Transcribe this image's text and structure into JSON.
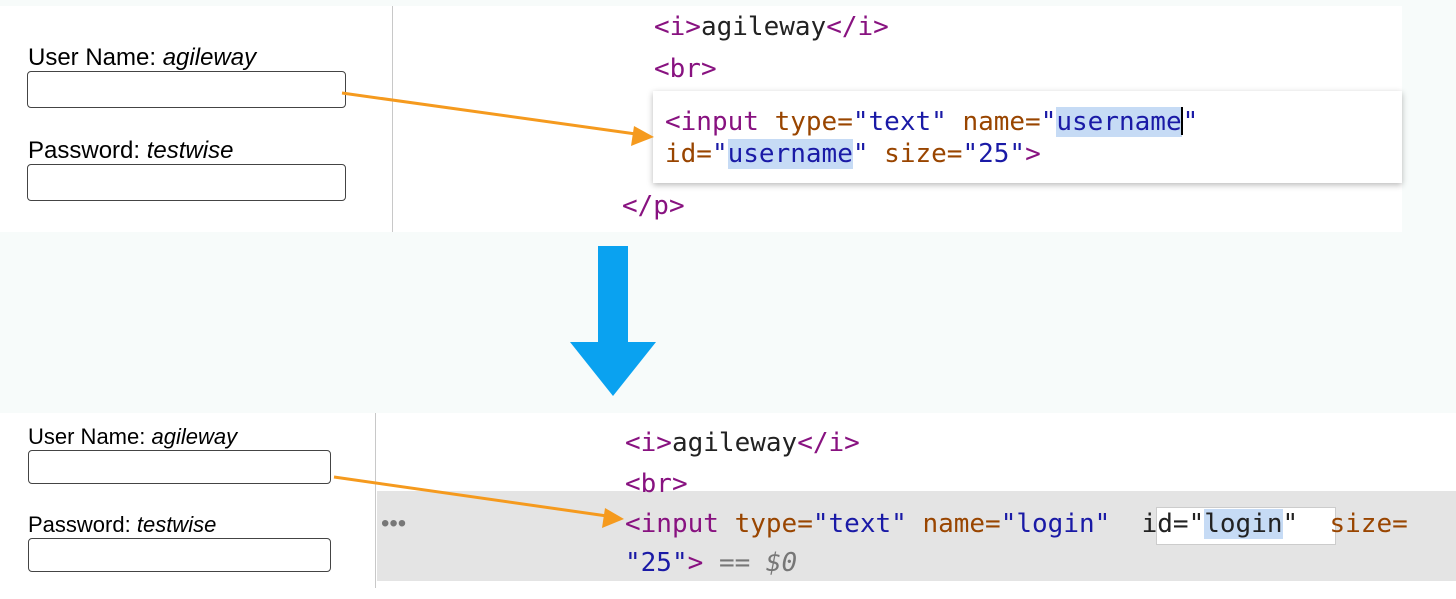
{
  "colors": {
    "pointer_arrow": "#f59a1e",
    "flow_arrow": "#0aa2f0",
    "tag": "#881280",
    "attribute": "#994500",
    "value": "#1a1aa6",
    "highlight": "#c6dbf5"
  },
  "before": {
    "form": {
      "username_label": "User Name:",
      "username_hint": "agileway",
      "password_label": "Password:",
      "password_hint": "testwise"
    },
    "code": {
      "line1": {
        "open": "<i>",
        "text": "agileway",
        "close": "</i>"
      },
      "line2": "<br>",
      "edit": {
        "open": "<input",
        "type_attr": "type=",
        "type_val": "\"text\"",
        "name_attr": "name=",
        "q1": "\"",
        "name_val": "username",
        "q2": "\"",
        "id_attr": "id=",
        "q3": "\"",
        "id_val": "username",
        "q4": "\"",
        "size_attr": "size=",
        "size_val": "\"25\"",
        "end": ">"
      },
      "line4": "</p>"
    }
  },
  "after": {
    "form": {
      "username_label": "User Name:",
      "username_hint": "agileway",
      "password_label": "Password:",
      "password_hint": "testwise"
    },
    "code": {
      "line1": {
        "open": "<i>",
        "text": "agileway",
        "close": "</i>"
      },
      "line2": "<br>",
      "row": {
        "ellipsis": "•••",
        "open": "<input",
        "type_attr": "type=",
        "type_val": "\"text\"",
        "name_attr": "name=",
        "name_val": "\"login\"",
        "id_attr": "id=",
        "q1": "\"",
        "id_val": "login",
        "q2": "\"",
        "size_attr": "size=",
        "size_val": "\"25\"",
        "end": ">",
        "eq": "==",
        "console_ref": "$0"
      }
    }
  },
  "arrow_icons": {
    "pointer": "arrow-right-icon",
    "flow": "arrow-down-icon"
  }
}
